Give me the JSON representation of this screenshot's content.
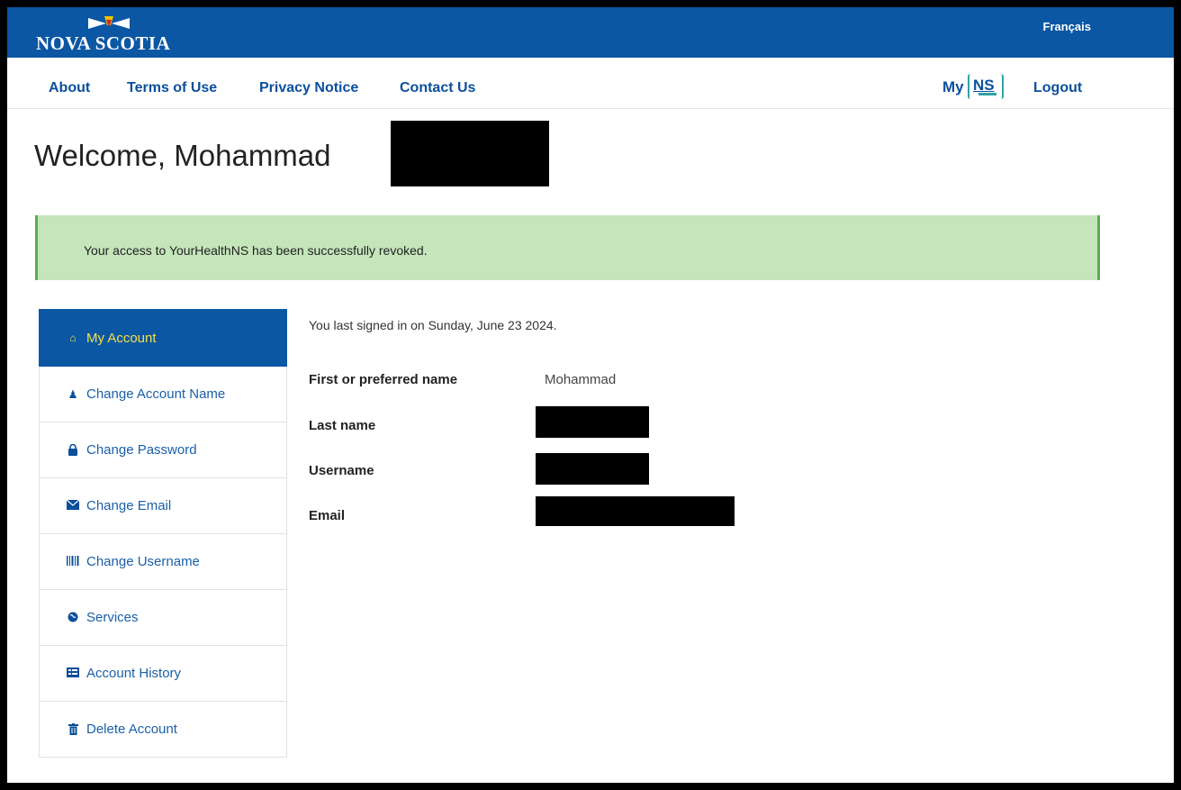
{
  "header": {
    "logo_text": "NOVA SCOTIA",
    "language_link": "Français"
  },
  "nav": {
    "links": [
      "About",
      "Terms of Use",
      "Privacy Notice",
      "Contact Us"
    ],
    "myns_my": "My",
    "myns_ns": "NS",
    "logout": "Logout"
  },
  "welcome": {
    "greeting": "Welcome, Mohammad"
  },
  "alert": {
    "message": "Your access to YourHealthNS has been successfully revoked."
  },
  "sidebar": {
    "items": [
      {
        "label": "My Account",
        "icon": "home-icon",
        "active": true
      },
      {
        "label": "Change Account Name",
        "icon": "user-icon"
      },
      {
        "label": "Change Password",
        "icon": "lock-icon"
      },
      {
        "label": "Change Email",
        "icon": "envelope-icon"
      },
      {
        "label": "Change Username",
        "icon": "barcode-icon"
      },
      {
        "label": "Services",
        "icon": "globe-icon"
      },
      {
        "label": "Account History",
        "icon": "list-icon"
      },
      {
        "label": "Delete Account",
        "icon": "trash-icon"
      }
    ]
  },
  "account": {
    "last_signed_in": "You last signed in on Sunday, June 23 2024.",
    "fields": [
      {
        "label": "First or preferred name",
        "value": "Mohammad"
      },
      {
        "label": "Last name",
        "value": ""
      },
      {
        "label": "Username",
        "value": ""
      },
      {
        "label": "Email",
        "value": ""
      }
    ]
  },
  "colors": {
    "brand_blue": "#0b57a4",
    "link_blue": "#0b4f9c",
    "alert_green_bg": "#c5e5bb",
    "alert_green_border": "#56b04a",
    "active_text_yellow": "#f5e04a"
  }
}
